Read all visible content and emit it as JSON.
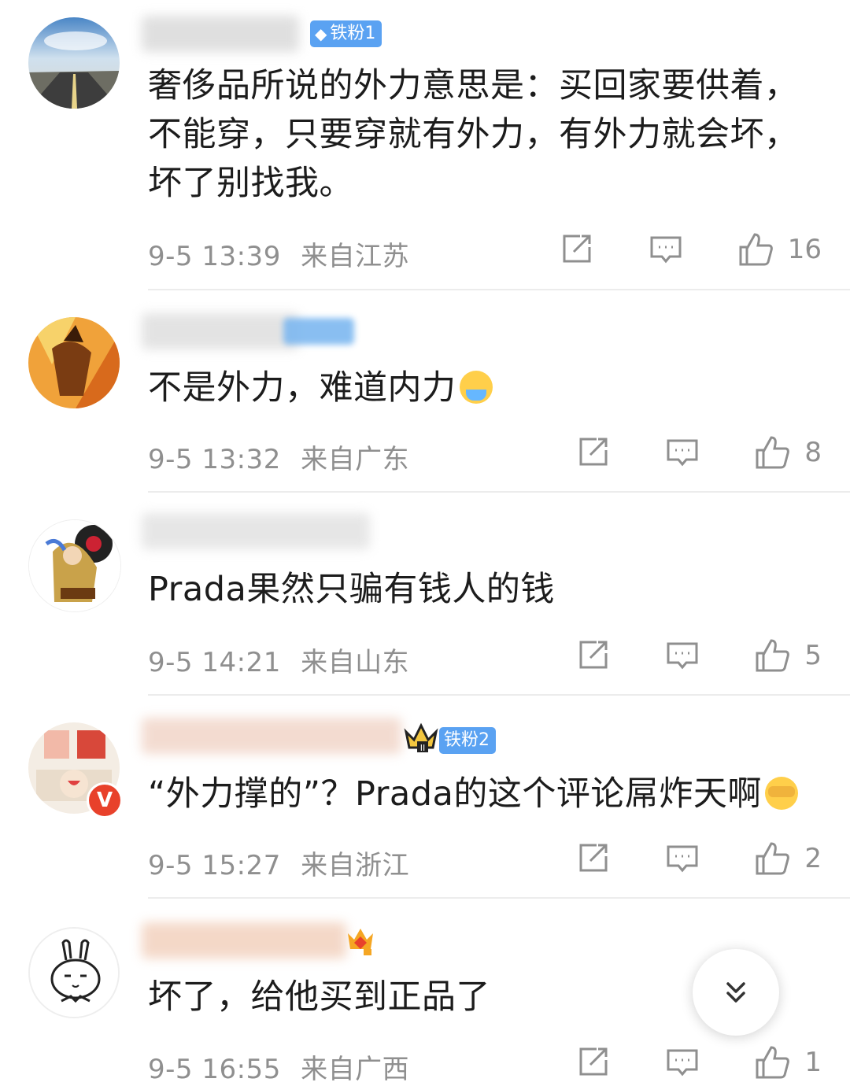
{
  "comments": [
    {
      "text": "奢侈品所说的外力意思是：买回家要供着，不能穿，只要穿就有外力，有外力就会坏，坏了别找我。",
      "time": "9-5 13:39",
      "location": "来自江苏",
      "likes": "16",
      "badge": "铁粉1"
    },
    {
      "text": "不是外力，难道内力",
      "time": "9-5 13:32",
      "location": "来自广东",
      "likes": "8"
    },
    {
      "text": "Prada果然只骗有钱人的钱",
      "time": "9-5 14:21",
      "location": "来自山东",
      "likes": "5"
    },
    {
      "text": "“外力撑的”？Prada的这个评论屌炸天啊",
      "time": "9-5 15:27",
      "location": "来自浙江",
      "likes": "2",
      "badge": "铁粉2"
    },
    {
      "text": "坏了，给他买到正品了",
      "time": "9-5 16:55",
      "location": "来自广西",
      "likes": "1"
    }
  ],
  "icons": {
    "share": "share-icon",
    "reply": "comment-icon",
    "like": "thumbs-up-icon",
    "scroll": "double-chevron-down-icon"
  },
  "colors": {
    "text": "#1c1c1c",
    "meta": "#8f8f8f",
    "badge_blue": "#5aa2f2",
    "verified_red": "#e8412b"
  }
}
